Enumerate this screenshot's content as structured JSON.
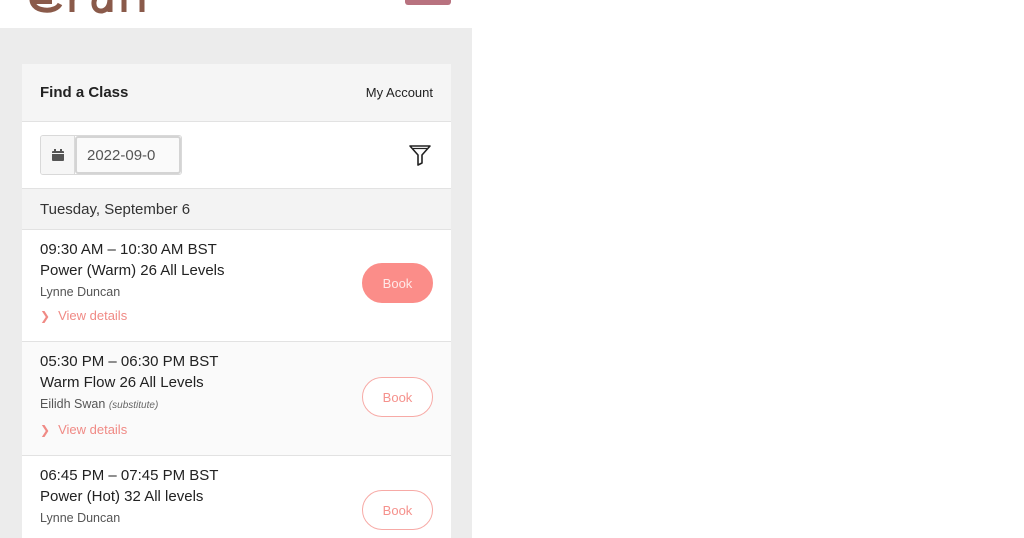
{
  "colors": {
    "accent": "#fb8d89",
    "accent_text": "#f08a85",
    "brand": "#b8727f",
    "panel_bg": "#ececec"
  },
  "header": {
    "menu_button_icon": "hamburger-icon"
  },
  "widget": {
    "title": "Find a Class",
    "account_link": "My Account",
    "date_value": "2022-09-0",
    "calendar_icon": "calendar-icon",
    "filter_icon": "filter-icon",
    "day_heading": "Tuesday, September 6"
  },
  "classes": [
    {
      "time": "09:30 AM – 10:30 AM BST",
      "name": "Power (Warm) 26 All Levels",
      "teacher": "Lynne Duncan",
      "substitute": "",
      "details_label": "View details",
      "book_label": "Book",
      "book_style": "filled"
    },
    {
      "time": "05:30 PM – 06:30 PM BST",
      "name": "Warm Flow 26 All Levels",
      "teacher": "Eilidh Swan",
      "substitute": "(substitute)",
      "details_label": "View details",
      "book_label": "Book",
      "book_style": "outline"
    },
    {
      "time": "06:45 PM – 07:45 PM BST",
      "name": "Power (Hot) 32 All levels",
      "teacher": "Lynne Duncan",
      "substitute": "",
      "details_label": "",
      "book_label": "Book",
      "book_style": "outline"
    }
  ]
}
